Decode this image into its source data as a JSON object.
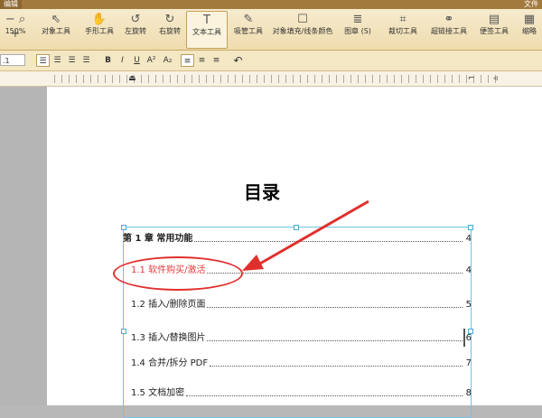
{
  "window": {
    "tab_label": "编辑",
    "menu_right": "文件"
  },
  "ribbon": {
    "tools": [
      {
        "name": "zoom",
        "icon": "zoom-icon",
        "label": "150%"
      },
      {
        "name": "select-object",
        "icon": "cursor-icon",
        "label": "对象工具"
      },
      {
        "name": "hand",
        "icon": "hand-icon",
        "label": "手形工具"
      },
      {
        "name": "rotate-left",
        "icon": "rotate-left-icon",
        "label": "左旋转"
      },
      {
        "name": "rotate-right",
        "icon": "rotate-right-icon",
        "label": "右旋转"
      },
      {
        "name": "text",
        "icon": "text-icon",
        "label": "文本工具"
      },
      {
        "name": "eyedropper",
        "icon": "eyedropper-icon",
        "label": "吸管工具"
      },
      {
        "name": "fill-color",
        "icon": "fill-icon",
        "label": "对象填充/线条颜色"
      },
      {
        "name": "layers",
        "icon": "layers-icon",
        "label": "图章 (S)"
      },
      {
        "name": "crop",
        "icon": "crop-icon",
        "label": "裁切工具"
      },
      {
        "name": "link",
        "icon": "link-icon",
        "label": "超链接工具"
      },
      {
        "name": "note",
        "icon": "note-icon",
        "label": "便签工具"
      },
      {
        "name": "thumbnail",
        "icon": "thumbnail-icon",
        "label": "缩略"
      }
    ]
  },
  "format_bar": {
    "font_size": ".1",
    "buttons": [
      "B",
      "I",
      "U",
      "A²",
      "A₂"
    ]
  },
  "document": {
    "title": "目录",
    "toc": [
      {
        "level": "chapter",
        "text": "第 1 章  常用功能",
        "page": "4"
      },
      {
        "level": "section",
        "text": "1.1 软件购买/激活",
        "page": "4",
        "highlighted": true
      },
      {
        "level": "section",
        "text": "1.2 插入/删除页面",
        "page": "5"
      },
      {
        "level": "section",
        "text": "1.3 插入/替换图片",
        "page": "6"
      },
      {
        "level": "section",
        "text": "1.4 合并/拆分 PDF",
        "page": "7"
      },
      {
        "level": "section",
        "text": "1.5 文档加密",
        "page": "8"
      }
    ]
  },
  "annotation_color": "#e0302e",
  "selection_color": "#6fc3e6"
}
